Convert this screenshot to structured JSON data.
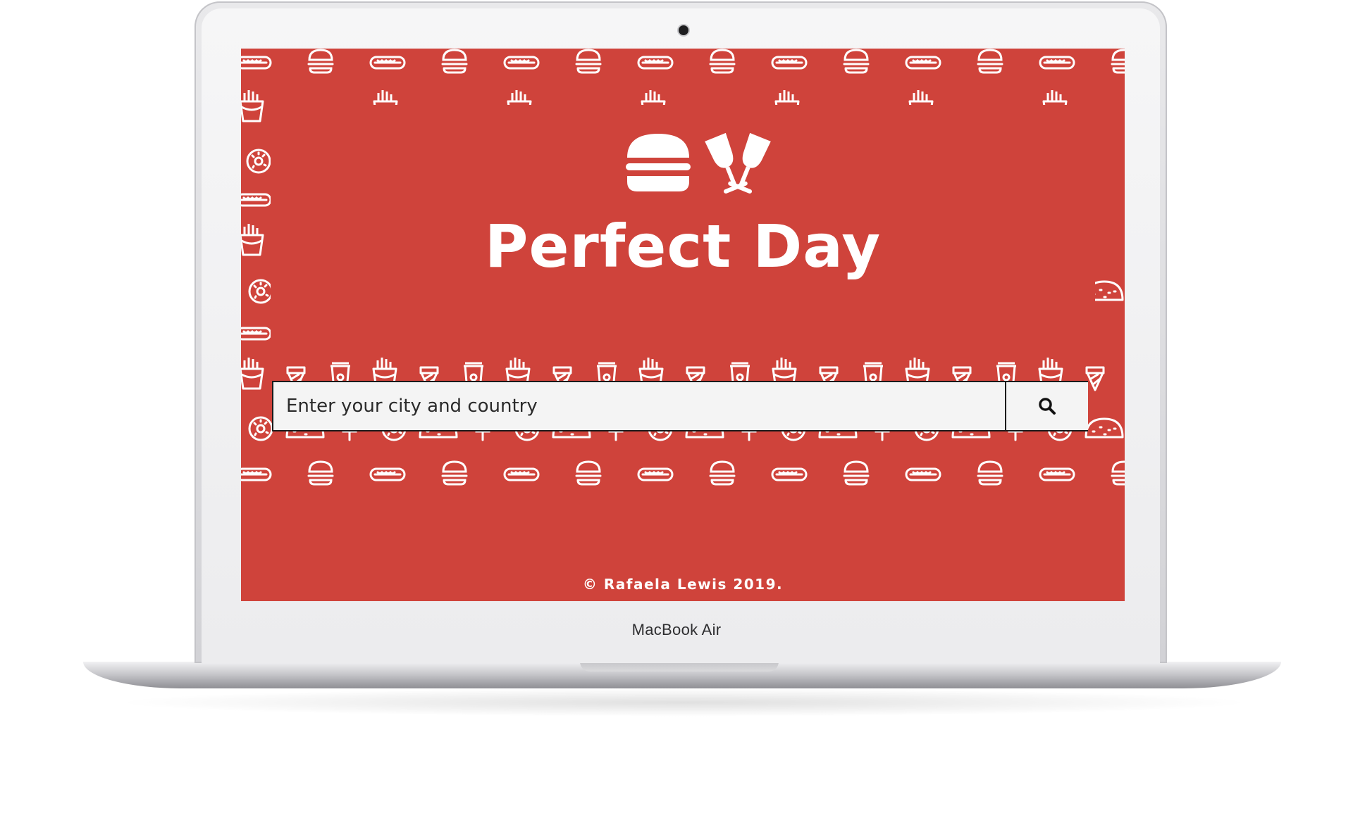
{
  "device": {
    "brand_label": "MacBook Air"
  },
  "app": {
    "title": "Perfect Day",
    "hero_icons": [
      "burger-icon",
      "wine-glasses-icon"
    ],
    "background_color": "#cf433b",
    "pattern_icons": [
      "hotdog-icon",
      "burger-icon",
      "fries-icon",
      "donut-icon",
      "taco-icon",
      "popsicle-icon",
      "ice-cream-cone-icon",
      "soda-cup-icon"
    ]
  },
  "search": {
    "placeholder": "Enter your city and country",
    "button_icon": "search-icon"
  },
  "footer": {
    "text": "© Rafaela Lewis 2019."
  }
}
